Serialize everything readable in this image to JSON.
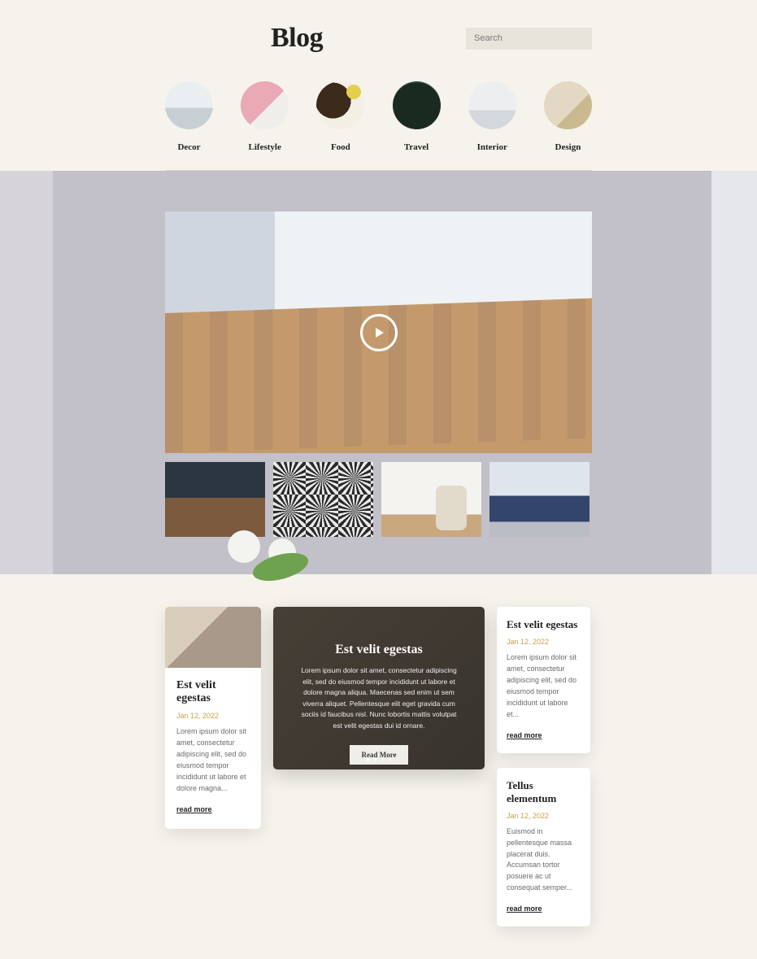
{
  "header": {
    "title": "Blog",
    "search_placeholder": "Search"
  },
  "categories": [
    {
      "label": "Decor"
    },
    {
      "label": "Lifestyle"
    },
    {
      "label": "Food"
    },
    {
      "label": "Travel"
    },
    {
      "label": "Interior"
    },
    {
      "label": "Design"
    }
  ],
  "feature_slider": {
    "title": "Est velit egestas",
    "excerpt": "Lorem ipsum dolor sit amet, consectetur adipiscing elit, sed do eiusmod tempor incididunt ut labore et dolore magna aliqua. Maecenas sed enim ut sem viverra aliquet. Pellentesque elit eget gravida cum sociis id faucibus nisl. Nunc lobortis mattis volutpat est velit egestas dui id ornare.",
    "button": "Read More",
    "active_dot": 0,
    "dot_count": 4
  },
  "cards": {
    "left": {
      "title": "Est velit egestas",
      "date": "Jan 12, 2022",
      "excerpt": "Lorem ipsum dolor sit amet, consectetur adipiscing elit, sed do eiusmod tempor incididunt ut labore et dolore magna...",
      "read_more": "read more"
    },
    "right_top": {
      "title": "Est velit egestas",
      "date": "Jan 12, 2022",
      "excerpt": "Lorem ipsum dolor sit amet, consectetur adipiscing elit, sed do eiusmod tempor incididunt ut labore et...",
      "read_more": "read more"
    },
    "right_bottom": {
      "title": "Tellus elementum",
      "date": "Jan 12, 2022",
      "excerpt": "Euismod in pellentesque massa placerat duis. Accumsan tortor posuere ac ut consequat semper...",
      "read_more": "read more"
    }
  }
}
